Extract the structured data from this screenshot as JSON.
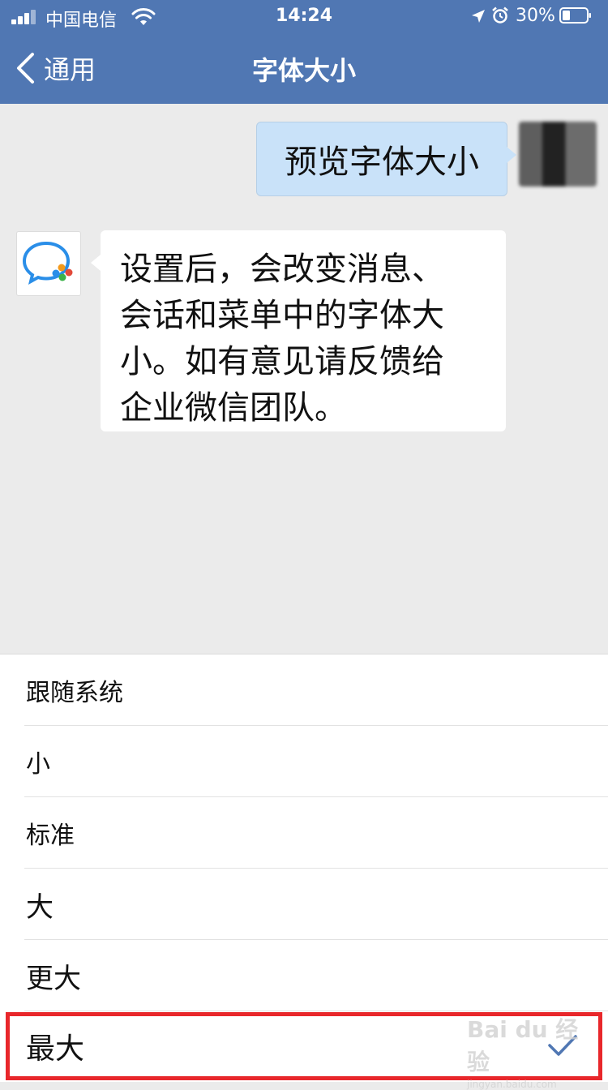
{
  "status_bar": {
    "carrier": "中国电信",
    "time": "14:24",
    "battery": "30%"
  },
  "nav": {
    "back_label": "通用",
    "title": "字体大小"
  },
  "preview": {
    "sent_message": "预览字体大小",
    "reply_message": "设置后，会改变消息、\n会话和菜单中的字体大\n小。如有意见请反馈给\n企业微信团队。"
  },
  "options": [
    {
      "label": "跟随系统",
      "selected": false
    },
    {
      "label": "小",
      "selected": false
    },
    {
      "label": "标准",
      "selected": false
    },
    {
      "label": "大",
      "selected": false
    },
    {
      "label": "更大",
      "selected": false
    },
    {
      "label": "最大",
      "selected": true
    }
  ],
  "colors": {
    "nav_bg": "#5077b3",
    "sent_bubble": "#c9e2f9",
    "highlight": "#e8272b",
    "check": "#5077b3"
  },
  "icons": {
    "back": "chevron-left-icon",
    "check": "checkmark-icon",
    "wifi": "wifi-icon",
    "location": "location-arrow-icon",
    "alarm": "alarm-clock-icon",
    "battery": "battery-icon"
  },
  "watermark": {
    "brand": "Bai du 经验",
    "url": "jingyan.baidu.com"
  }
}
